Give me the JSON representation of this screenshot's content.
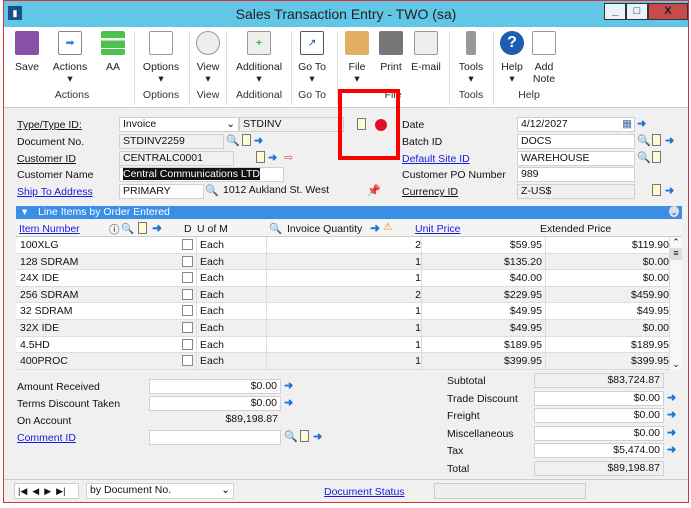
{
  "window": {
    "title": "Sales Transaction Entry  -  TWO (sa)",
    "minimize": "_",
    "maximize": "□",
    "close": "X"
  },
  "ribbon": {
    "buttons": [
      "Save",
      "Actions",
      "AA",
      "Options",
      "View",
      "Additional",
      "Go To",
      "File",
      "Print",
      "E-mail",
      "Tools",
      "Help",
      "Add Note"
    ],
    "groups": [
      "Actions",
      "Options",
      "View",
      "Additional",
      "Go To",
      "File",
      "Tools",
      "Help"
    ]
  },
  "header": {
    "type_label": "Type/Type ID:",
    "type_value": "Invoice",
    "type_id": "STDINV",
    "docno_label": "Document No.",
    "docno_value": "STDINV2259",
    "custid_label": "Customer ID",
    "custid_value": "CENTRALC0001",
    "custname_label": "Customer Name",
    "custname_value": "Central Communications LTD",
    "shipto_label": "Ship To Address",
    "shipto_value": "PRIMARY",
    "shipto_address": "1012 Aukland St. West",
    "date_label": "Date",
    "date_value": "4/12/2027",
    "batch_label": "Batch ID",
    "batch_value": "DOCS",
    "site_label": "Default Site ID",
    "site_value": "WAREHOUSE",
    "po_label": "Customer PO Number",
    "po_value": "989",
    "currency_label": "Currency ID",
    "currency_value": "Z-US$"
  },
  "grid": {
    "title": "Line Items by Order Entered",
    "columns": [
      "Item Number",
      "D",
      "U of M",
      "Invoice Quantity",
      "Unit Price",
      "Extended Price"
    ],
    "rows": [
      {
        "item": "100XLG",
        "uom": "Each",
        "qty": "2",
        "price": "$59.95",
        "ext": "$119.90"
      },
      {
        "item": "128 SDRAM",
        "uom": "Each",
        "qty": "1",
        "price": "$135.20",
        "ext": "$0.00"
      },
      {
        "item": "24X IDE",
        "uom": "Each",
        "qty": "1",
        "price": "$40.00",
        "ext": "$0.00"
      },
      {
        "item": "256 SDRAM",
        "uom": "Each",
        "qty": "2",
        "price": "$229.95",
        "ext": "$459.90"
      },
      {
        "item": "32 SDRAM",
        "uom": "Each",
        "qty": "1",
        "price": "$49.95",
        "ext": "$49.95"
      },
      {
        "item": "32X IDE",
        "uom": "Each",
        "qty": "1",
        "price": "$49.95",
        "ext": "$0.00"
      },
      {
        "item": "4.5HD",
        "uom": "Each",
        "qty": "1",
        "price": "$189.95",
        "ext": "$189.95"
      },
      {
        "item": "400PROC",
        "uom": "Each",
        "qty": "1",
        "price": "$399.95",
        "ext": "$399.95"
      }
    ]
  },
  "payments": {
    "amount_received_label": "Amount Received",
    "amount_received": "$0.00",
    "terms_label": "Terms Discount Taken",
    "terms": "$0.00",
    "on_account_label": "On Account",
    "on_account": "$89,198.87",
    "comment_label": "Comment ID",
    "comment": ""
  },
  "totals": {
    "subtotal_label": "Subtotal",
    "subtotal": "$83,724.87",
    "trade_label": "Trade Discount",
    "trade": "$0.00",
    "freight_label": "Freight",
    "freight": "$0.00",
    "misc_label": "Miscellaneous",
    "misc": "$0.00",
    "tax_label": "Tax",
    "tax": "$5,474.00",
    "total_label": "Total",
    "total": "$89,198.87"
  },
  "footer": {
    "nav": [
      "|◀",
      "◀",
      "▶",
      "▶|"
    ],
    "sort": "by Document No.",
    "status_link": "Document Status"
  }
}
